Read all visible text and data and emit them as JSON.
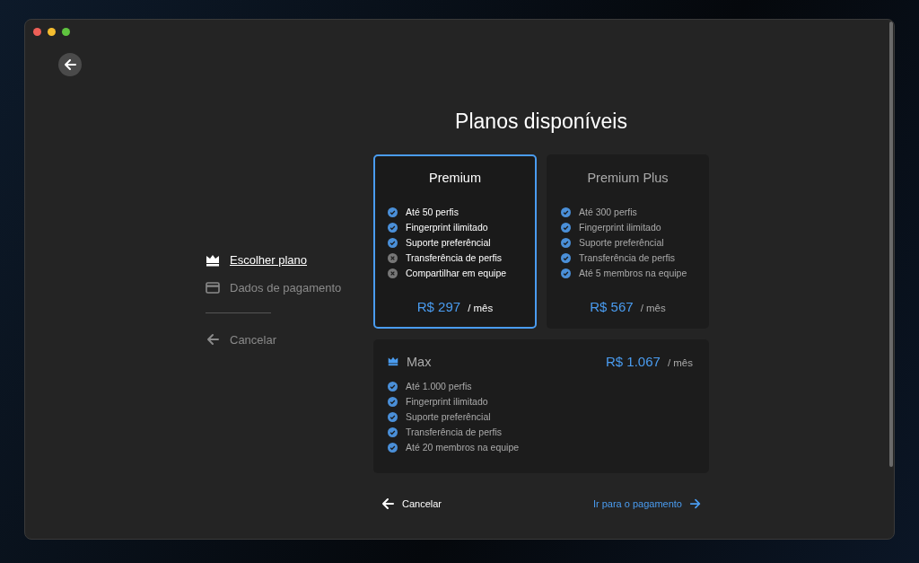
{
  "steps": [
    {
      "label": "Escolher plano",
      "kind": "plan",
      "selected": true
    },
    {
      "label": "Dados de pagamento",
      "kind": "payment",
      "selected": false
    }
  ],
  "sidebar_cancel": "Cancelar",
  "title": "Planos disponíveis",
  "plans": [
    {
      "kind": "card",
      "name": "Premium",
      "selected": true,
      "price": "R$ 297",
      "period": "/ mês",
      "features": [
        {
          "label": "Até 50 perfis",
          "included": true
        },
        {
          "label": "Fingerprint ilimitado",
          "included": true
        },
        {
          "label": "Suporte preferêncial",
          "included": true
        },
        {
          "label": "Transferência de perfis",
          "included": false
        },
        {
          "label": "Compartilhar em equipe",
          "included": false
        }
      ]
    },
    {
      "kind": "card",
      "name": "Premium Plus",
      "selected": false,
      "price": "R$ 567",
      "period": "/ mês",
      "features": [
        {
          "label": "Até 300 perfis",
          "included": true
        },
        {
          "label": "Fingerprint ilimitado",
          "included": true
        },
        {
          "label": "Suporte preferêncial",
          "included": true
        },
        {
          "label": "Transferência de perfis",
          "included": true
        },
        {
          "label": "Até 5 membros na equipe",
          "included": true
        }
      ]
    },
    {
      "kind": "wide",
      "name": "Max",
      "selected": false,
      "price": "R$ 1.067",
      "period": "/ mês",
      "features": [
        {
          "label": "Até 1.000 perfis",
          "included": true
        },
        {
          "label": "Fingerprint ilimitado",
          "included": true
        },
        {
          "label": "Suporte preferêncial",
          "included": true
        },
        {
          "label": "Transferência de perfis",
          "included": true
        },
        {
          "label": "Até 20 membros na equipe",
          "included": true
        }
      ]
    }
  ],
  "footer": {
    "cancel": "Cancelar",
    "next": "Ir para o pagamento"
  }
}
